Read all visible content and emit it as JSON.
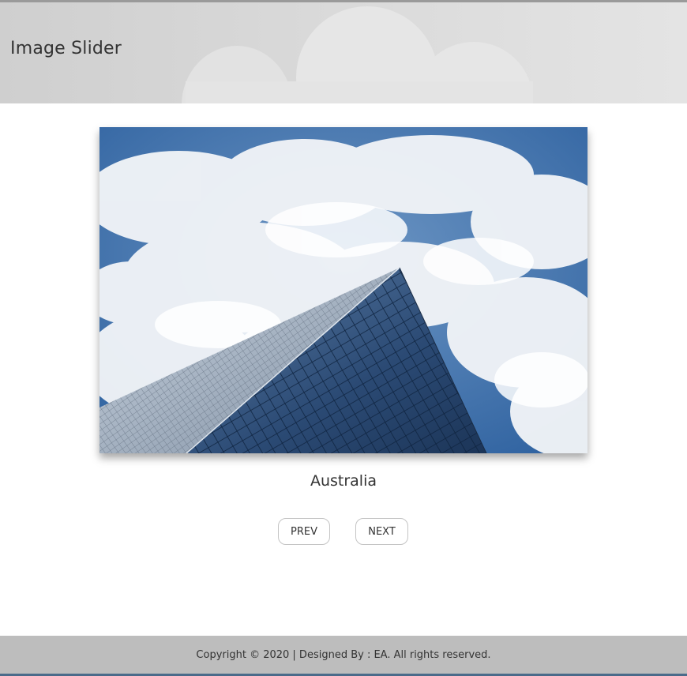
{
  "header": {
    "title": "Image Slider"
  },
  "slider": {
    "caption": "Australia",
    "image_description_icon": "skyscraper-clouds-photo",
    "prev_label": "PREV",
    "next_label": "NEXT"
  },
  "footer": {
    "text": "Copyright © 2020 | Designed By : EA. All rights reserved."
  },
  "colors": {
    "header_bg": "#d6d6d6",
    "footer_bg": "#bdbdbd",
    "sky_blue": "#3a6ea8",
    "text": "#333333"
  }
}
